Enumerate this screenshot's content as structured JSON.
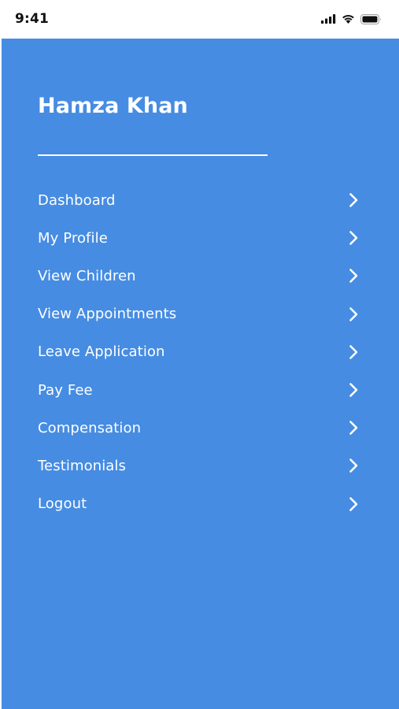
{
  "status_bar": {
    "time": "9:41",
    "icons": [
      "signal-bars-icon",
      "wifi-icon",
      "battery-icon"
    ]
  },
  "drawer": {
    "background_color": "#468ce2",
    "user_name": "Hamza Khan",
    "menu": [
      {
        "label": "Dashboard",
        "icon": "chevron-right-icon"
      },
      {
        "label": "My Profile",
        "icon": "chevron-right-icon"
      },
      {
        "label": "View Children",
        "icon": "chevron-right-icon"
      },
      {
        "label": "View Appointments",
        "icon": "chevron-right-icon"
      },
      {
        "label": "Leave Application",
        "icon": "chevron-right-icon"
      },
      {
        "label": "Pay Fee",
        "icon": "chevron-right-icon"
      },
      {
        "label": "Compensation",
        "icon": "chevron-right-icon"
      },
      {
        "label": "Testimonials",
        "icon": "chevron-right-icon"
      },
      {
        "label": "Logout",
        "icon": "chevron-right-icon"
      }
    ]
  }
}
